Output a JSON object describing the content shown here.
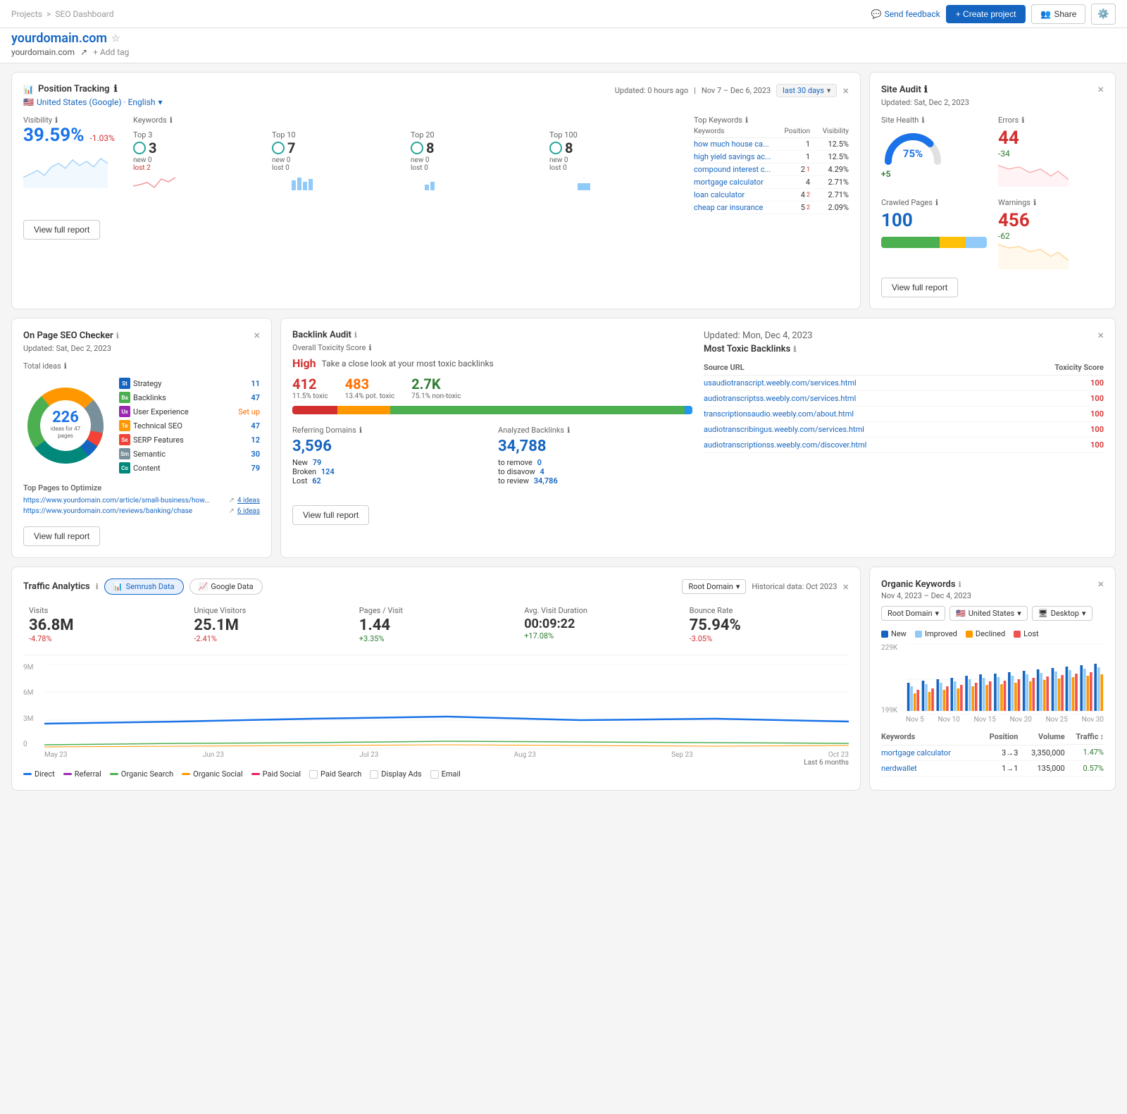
{
  "topbar": {
    "breadcrumb_projects": "Projects",
    "breadcrumb_sep": ">",
    "breadcrumb_current": "SEO Dashboard",
    "send_feedback": "Send feedback",
    "create_project": "+ Create project",
    "share": "Share",
    "feedback_icon": "💬"
  },
  "domain": {
    "name": "yourdomain.com",
    "url": "yourdomain.com",
    "add_tag": "+ Add tag"
  },
  "position_tracking": {
    "title": "Position Tracking",
    "updated": "Updated: 0 hours ago",
    "date_range": "Nov 7 – Dec 6, 2023",
    "last_period": "last 30 days",
    "location": "United States (Google) · English",
    "visibility_label": "Visibility",
    "visibility_value": "39.59%",
    "visibility_change": "-1.03%",
    "keywords_label": "Keywords",
    "top3_label": "Top 3",
    "top3_value": "3",
    "top3_new": "0",
    "top3_lost": "2",
    "top10_label": "Top 10",
    "top10_value": "7",
    "top10_new": "0",
    "top10_lost": "0",
    "top20_label": "Top 20",
    "top20_value": "8",
    "top20_new": "0",
    "top20_lost": "0",
    "top100_label": "Top 100",
    "top100_value": "8",
    "top100_new": "0",
    "top100_lost": "0",
    "top_keywords_label": "Top Keywords",
    "keywords_col": "Keywords",
    "position_col": "Position",
    "visibility_col": "Visibility",
    "keywords": [
      {
        "name": "how much house ca...",
        "position": "1",
        "pos_change": "0",
        "visibility": "12.5%"
      },
      {
        "name": "high yield savings ac...",
        "position": "1",
        "pos_change": "0",
        "visibility": "12.5%"
      },
      {
        "name": "compound interest c...",
        "position": "2",
        "pos_change": "1",
        "visibility": "4.29%"
      },
      {
        "name": "mortgage calculator",
        "position": "4",
        "pos_change": "0",
        "visibility": "2.71%"
      },
      {
        "name": "loan calculator",
        "position": "4",
        "pos_change": "2",
        "visibility": "2.71%"
      },
      {
        "name": "cheap car insurance",
        "position": "5",
        "pos_change": "2",
        "visibility": "2.09%"
      }
    ],
    "view_full_report": "View full report"
  },
  "site_audit": {
    "title": "Site Audit",
    "updated": "Updated: Sat, Dec 2, 2023",
    "health_label": "Site Health",
    "health_value": "75%",
    "health_change": "+5",
    "errors_label": "Errors",
    "errors_value": "44",
    "errors_change": "-34",
    "crawled_label": "Crawled Pages",
    "crawled_value": "100",
    "warnings_label": "Warnings",
    "warnings_value": "456",
    "warnings_change": "-62",
    "view_full_report": "View full report"
  },
  "on_page_seo": {
    "title": "On Page SEO Checker",
    "updated": "Updated: Sat, Dec 2, 2023",
    "total_ideas_label": "Total ideas",
    "ideas_value": "226",
    "ideas_sub": "ideas for 47 pages",
    "categories": [
      {
        "label": "Strategy",
        "code": "St",
        "color": "#1565c0",
        "count": "11"
      },
      {
        "label": "Backlinks",
        "code": "Ba",
        "color": "#4caf50",
        "count": "47"
      },
      {
        "label": "User Experience",
        "code": "Ux",
        "color": "#9c27b0",
        "count": "",
        "setup": "Set up"
      },
      {
        "label": "Technical SEO",
        "code": "Te",
        "color": "#ff9800",
        "count": "47"
      },
      {
        "label": "SERP Features",
        "code": "Se",
        "color": "#f44336",
        "count": "12"
      },
      {
        "label": "Semantic",
        "code": "Sm",
        "color": "#78909c",
        "count": "30"
      },
      {
        "label": "Content",
        "code": "Co",
        "color": "#00897b",
        "count": "79"
      }
    ],
    "top_pages_label": "Top Pages to Optimize",
    "pages": [
      {
        "url": "https://www.yourdomain.com/article/small-business/how...",
        "ideas": "4 ideas"
      },
      {
        "url": "https://www.yourdomain.com/reviews/banking/chase",
        "ideas": "6 ideas"
      }
    ],
    "view_full_report": "View full report"
  },
  "backlink_audit": {
    "title": "Backlink Audit",
    "updated": "Updated: Mon, Dec 4, 2023",
    "toxicity_label": "Overall Toxicity Score",
    "toxicity_level": "High",
    "toxicity_desc": "Take a close look at your most toxic backlinks",
    "toxic_count": "412",
    "toxic_pct": "11.5% toxic",
    "pot_toxic_count": "483",
    "pot_toxic_pct": "13.4% pot. toxic",
    "non_toxic_count": "2.7K",
    "non_toxic_pct": "75.1% non-toxic",
    "ref_domains_label": "Referring Domains",
    "ref_domains_value": "3,596",
    "ref_new_label": "New",
    "ref_new_value": "79",
    "ref_broken_label": "Broken",
    "ref_broken_value": "124",
    "ref_lost_label": "Lost",
    "ref_lost_value": "62",
    "analyzed_label": "Analyzed Backlinks",
    "analyzed_value": "34,788",
    "to_remove_label": "to remove",
    "to_remove_value": "0",
    "to_disavow_label": "to disavow",
    "to_disavow_value": "4",
    "to_review_label": "to review",
    "to_review_value": "34,786",
    "most_toxic_label": "Most Toxic Backlinks",
    "source_url_col": "Source URL",
    "toxicity_score_col": "Toxicity Score",
    "toxic_links": [
      {
        "url": "usaudiotranscript.weebly.com/services.html",
        "score": "100"
      },
      {
        "url": "audiotranscriptss.weebly.com/services.html",
        "score": "100"
      },
      {
        "url": "transcriptionsaudio.weebly.com/about.html",
        "score": "100"
      },
      {
        "url": "audiotranscribingus.weebly.com/services.html",
        "score": "100"
      },
      {
        "url": "audiotranscriptionss.weebly.com/discover.html",
        "score": "100"
      }
    ],
    "view_full_report": "View full report"
  },
  "traffic_analytics": {
    "title": "Traffic Analytics",
    "semrush_tab": "Semrush Data",
    "google_tab": "Google Data",
    "root_domain": "Root Domain",
    "historical_data": "Historical data: Oct 2023",
    "visits_label": "Visits",
    "visits_value": "36.8M",
    "visits_change": "-4.78%",
    "unique_label": "Unique Visitors",
    "unique_value": "25.1M",
    "unique_change": "-2.41%",
    "pages_label": "Pages / Visit",
    "pages_value": "1.44",
    "pages_change": "+3.35%",
    "duration_label": "Avg. Visit Duration",
    "duration_value": "00:09:22",
    "duration_change": "+17.08%",
    "bounce_label": "Bounce Rate",
    "bounce_value": "75.94%",
    "bounce_change": "-3.05%",
    "last_6_months": "Last 6 months",
    "chart_labels": [
      "May 23",
      "Jun 23",
      "Jul 23",
      "Aug 23",
      "Sep 23",
      "Oct 23"
    ],
    "chart_y_labels": [
      "9M",
      "6M",
      "3M",
      "0"
    ],
    "legend": [
      "Direct",
      "Referral",
      "Organic Search",
      "Organic Social",
      "Paid Social",
      "Paid Search",
      "Display Ads",
      "Email"
    ]
  },
  "organic_keywords": {
    "title": "Organic Keywords",
    "date_range": "Nov 4, 2023 – Dec 4, 2023",
    "root_domain": "Root Domain",
    "country": "United States",
    "device": "Desktop",
    "new_label": "New",
    "improved_label": "Improved",
    "declined_label": "Declined",
    "lost_label": "Lost",
    "chart_y_high": "229K",
    "chart_y_low": "199K",
    "chart_x_labels": [
      "Nov 5",
      "Nov 10",
      "Nov 15",
      "Nov 20",
      "Nov 25",
      "Nov 30"
    ],
    "keywords_col": "Keywords",
    "position_col": "Position",
    "volume_col": "Volume",
    "traffic_col": "Traffic",
    "rows": [
      {
        "keyword": "mortgage calculator",
        "position": "3→3",
        "volume": "3,350,000",
        "traffic": "1.47%"
      },
      {
        "keyword": "nerdwallet",
        "position": "1→1",
        "volume": "135,000",
        "traffic": "0.57%"
      }
    ]
  }
}
